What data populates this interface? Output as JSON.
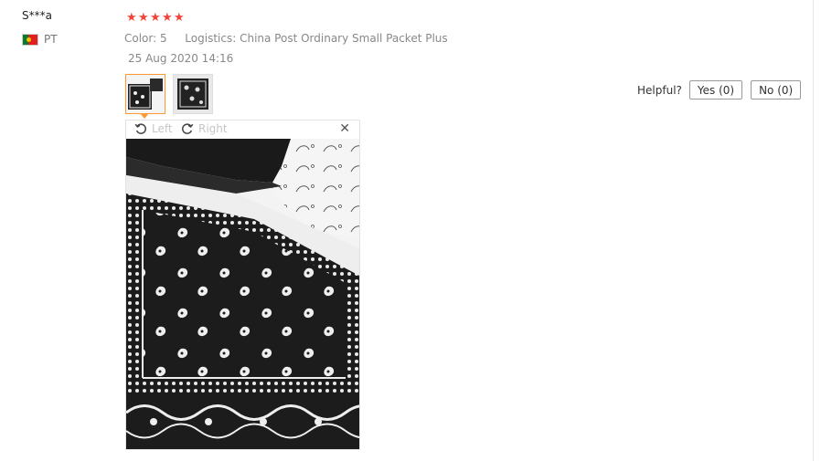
{
  "review": {
    "user_name": "S***a",
    "country_code": "PT",
    "rating": 5,
    "star_color": "#f44336",
    "color_label": "Color:",
    "color_value": "5",
    "logistics_label": "Logistics:",
    "logistics_value": "China Post Ordinary Small Packet Plus",
    "date": "25 Aug 2020 14:16",
    "thumbnails": [
      "bandana-photo-1",
      "bandana-photo-2"
    ],
    "active_thumb_color": "#ff9933"
  },
  "helpful": {
    "label": "Helpful?",
    "yes_label": "Yes (0)",
    "no_label": "No (0)"
  },
  "viewer": {
    "rotate_left_label": "Left",
    "rotate_right_label": "Right",
    "close_icon": "close-icon"
  }
}
